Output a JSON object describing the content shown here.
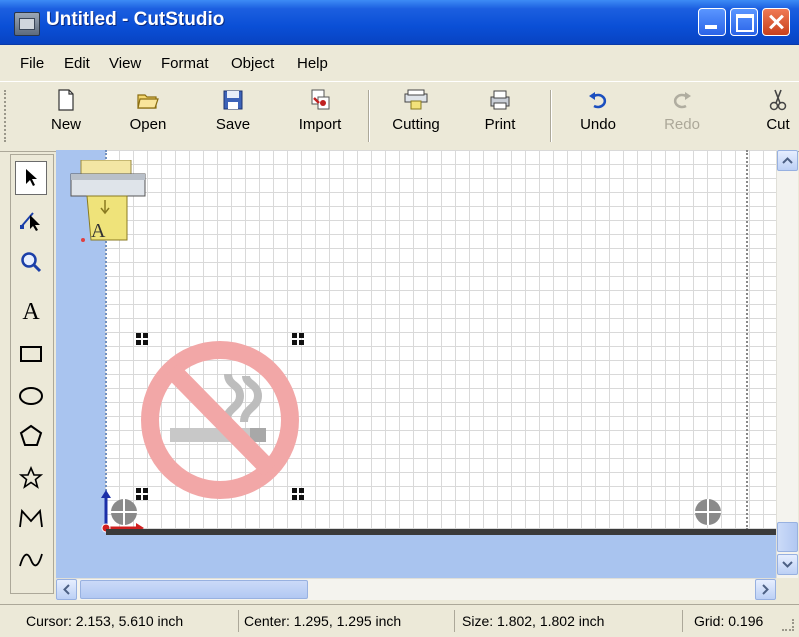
{
  "window": {
    "title": "Untitled - CutStudio",
    "title_bar_color": "#0a4fd6"
  },
  "menu": {
    "items": [
      "File",
      "Edit",
      "View",
      "Format",
      "Object",
      "Help"
    ]
  },
  "toolbar": {
    "new_label": "New",
    "open_label": "Open",
    "save_label": "Save",
    "import_label": "Import",
    "cutting_label": "Cutting",
    "print_label": "Print",
    "undo_label": "Undo",
    "redo_label": "Redo",
    "cut_label": "Cut"
  },
  "tools": {
    "text_tool_label": "A",
    "items": [
      "select-tool",
      "node-edit-tool",
      "zoom-tool",
      "text-tool",
      "rectangle-tool",
      "ellipse-tool",
      "polygon-tool",
      "star-tool",
      "polyline-tool",
      "curve-tool"
    ],
    "active": "select-tool"
  },
  "canvas": {
    "sticker_letter": "A",
    "colors": {
      "workspace": "#a9c4ef",
      "no_smoking_ring": "#f2a7a7",
      "cut_line": "#3a3a3a"
    }
  },
  "status": {
    "cursor": "Cursor: 2.153, 5.610 inch",
    "center": "Center: 1.295, 1.295 inch",
    "size": "Size: 1.802, 1.802 inch",
    "grid": "Grid: 0.196"
  }
}
